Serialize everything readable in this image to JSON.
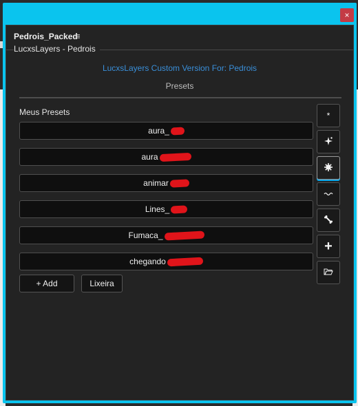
{
  "window": {
    "close_label": "×"
  },
  "panel": {
    "tab_title": "Pedrois_Packed",
    "menu_glyph": "≡",
    "group_title": "LucxsLayers - Pedrois",
    "custom_version": "LucxsLayers Custom Version For: Pedrois",
    "presets_header": "Presets",
    "my_presets_label": "Meus Presets"
  },
  "presets": [
    {
      "label": "aura_"
    },
    {
      "label": "aura"
    },
    {
      "label": "animar"
    },
    {
      "label": "Lines_"
    },
    {
      "label": "Fumaca_"
    },
    {
      "label": "chegando"
    }
  ],
  "buttons": {
    "add": "+ Add",
    "trash": "Lixeira"
  },
  "tools": [
    {
      "icon": "asterisk-icon",
      "glyph": "*"
    },
    {
      "icon": "sparkle-icon",
      "glyph": "✦"
    },
    {
      "icon": "gear-icon",
      "glyph": "✹"
    },
    {
      "icon": "wave-icon",
      "glyph": "〰"
    },
    {
      "icon": "bone-icon",
      "glyph": "🦴"
    },
    {
      "icon": "plus-icon",
      "glyph": "+"
    },
    {
      "icon": "folder-open-icon",
      "glyph": "📂"
    }
  ],
  "colors": {
    "titlebar": "#0ac4ee",
    "close": "#c43b45",
    "link": "#3a8fd9"
  }
}
